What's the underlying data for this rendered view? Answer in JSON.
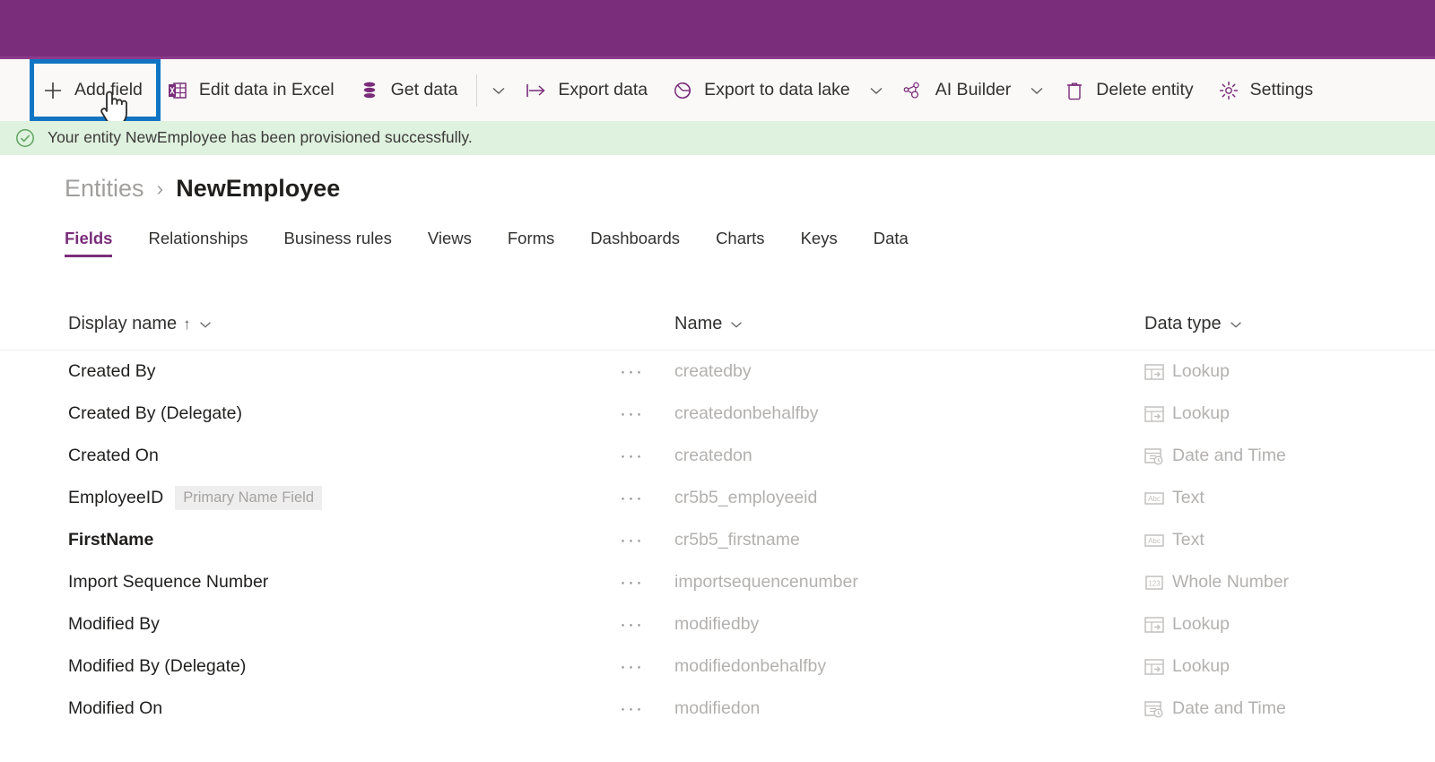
{
  "appbar": {
    "background": "#7a2d7a"
  },
  "toolbar": {
    "commands": [
      {
        "label": "Add field",
        "icon": "plus-icon"
      },
      {
        "label": "Edit data in Excel",
        "icon": "excel-icon"
      },
      {
        "label": "Get data",
        "icon": "database-icon"
      },
      {
        "label": "Export data",
        "icon": "export-icon"
      },
      {
        "label": "Export to data lake",
        "icon": "data-lake-icon"
      },
      {
        "label": "AI Builder",
        "icon": "ai-builder-icon"
      },
      {
        "label": "Delete entity",
        "icon": "trash-icon"
      },
      {
        "label": "Settings",
        "icon": "gear-icon"
      }
    ],
    "highlight_color": "#1175c4",
    "highlighted_command": "Add field"
  },
  "notification": {
    "text": "Your entity NewEmployee has been provisioned successfully.",
    "icon": "check-circle-icon",
    "background": "#dff2df",
    "accent": "#5fa35f"
  },
  "breadcrumb": {
    "parent": "Entities",
    "separator": "›",
    "current": "NewEmployee"
  },
  "tabs": [
    {
      "label": "Fields",
      "active": true
    },
    {
      "label": "Relationships",
      "active": false
    },
    {
      "label": "Business rules",
      "active": false
    },
    {
      "label": "Views",
      "active": false
    },
    {
      "label": "Forms",
      "active": false
    },
    {
      "label": "Dashboards",
      "active": false
    },
    {
      "label": "Charts",
      "active": false
    },
    {
      "label": "Keys",
      "active": false
    },
    {
      "label": "Data",
      "active": false
    }
  ],
  "table": {
    "columns": [
      {
        "label": "Display name",
        "sort": "↑",
        "chevron": true
      },
      {
        "label": "Name",
        "sort": "",
        "chevron": true
      },
      {
        "label": "Data type",
        "sort": "",
        "chevron": true
      }
    ],
    "row_menu": "···",
    "rows": [
      {
        "display_name": "Created By",
        "badge": "",
        "bold": false,
        "name": "createdby",
        "data_type": "Lookup",
        "type_icon": "lookup-icon"
      },
      {
        "display_name": "Created By (Delegate)",
        "badge": "",
        "bold": false,
        "name": "createdonbehalfby",
        "data_type": "Lookup",
        "type_icon": "lookup-icon"
      },
      {
        "display_name": "Created On",
        "badge": "",
        "bold": false,
        "name": "createdon",
        "data_type": "Date and Time",
        "type_icon": "datetime-icon"
      },
      {
        "display_name": "EmployeeID",
        "badge": "Primary Name Field",
        "bold": false,
        "name": "cr5b5_employeeid",
        "data_type": "Text",
        "type_icon": "text-icon"
      },
      {
        "display_name": "FirstName",
        "badge": "",
        "bold": true,
        "name": "cr5b5_firstname",
        "data_type": "Text",
        "type_icon": "text-icon"
      },
      {
        "display_name": "Import Sequence Number",
        "badge": "",
        "bold": false,
        "name": "importsequencenumber",
        "data_type": "Whole Number",
        "type_icon": "number-icon"
      },
      {
        "display_name": "Modified By",
        "badge": "",
        "bold": false,
        "name": "modifiedby",
        "data_type": "Lookup",
        "type_icon": "lookup-icon"
      },
      {
        "display_name": "Modified By (Delegate)",
        "badge": "",
        "bold": false,
        "name": "modifiedonbehalfby",
        "data_type": "Lookup",
        "type_icon": "lookup-icon"
      },
      {
        "display_name": "Modified On",
        "badge": "",
        "bold": false,
        "name": "modifiedon",
        "data_type": "Date and Time",
        "type_icon": "datetime-icon"
      }
    ]
  }
}
